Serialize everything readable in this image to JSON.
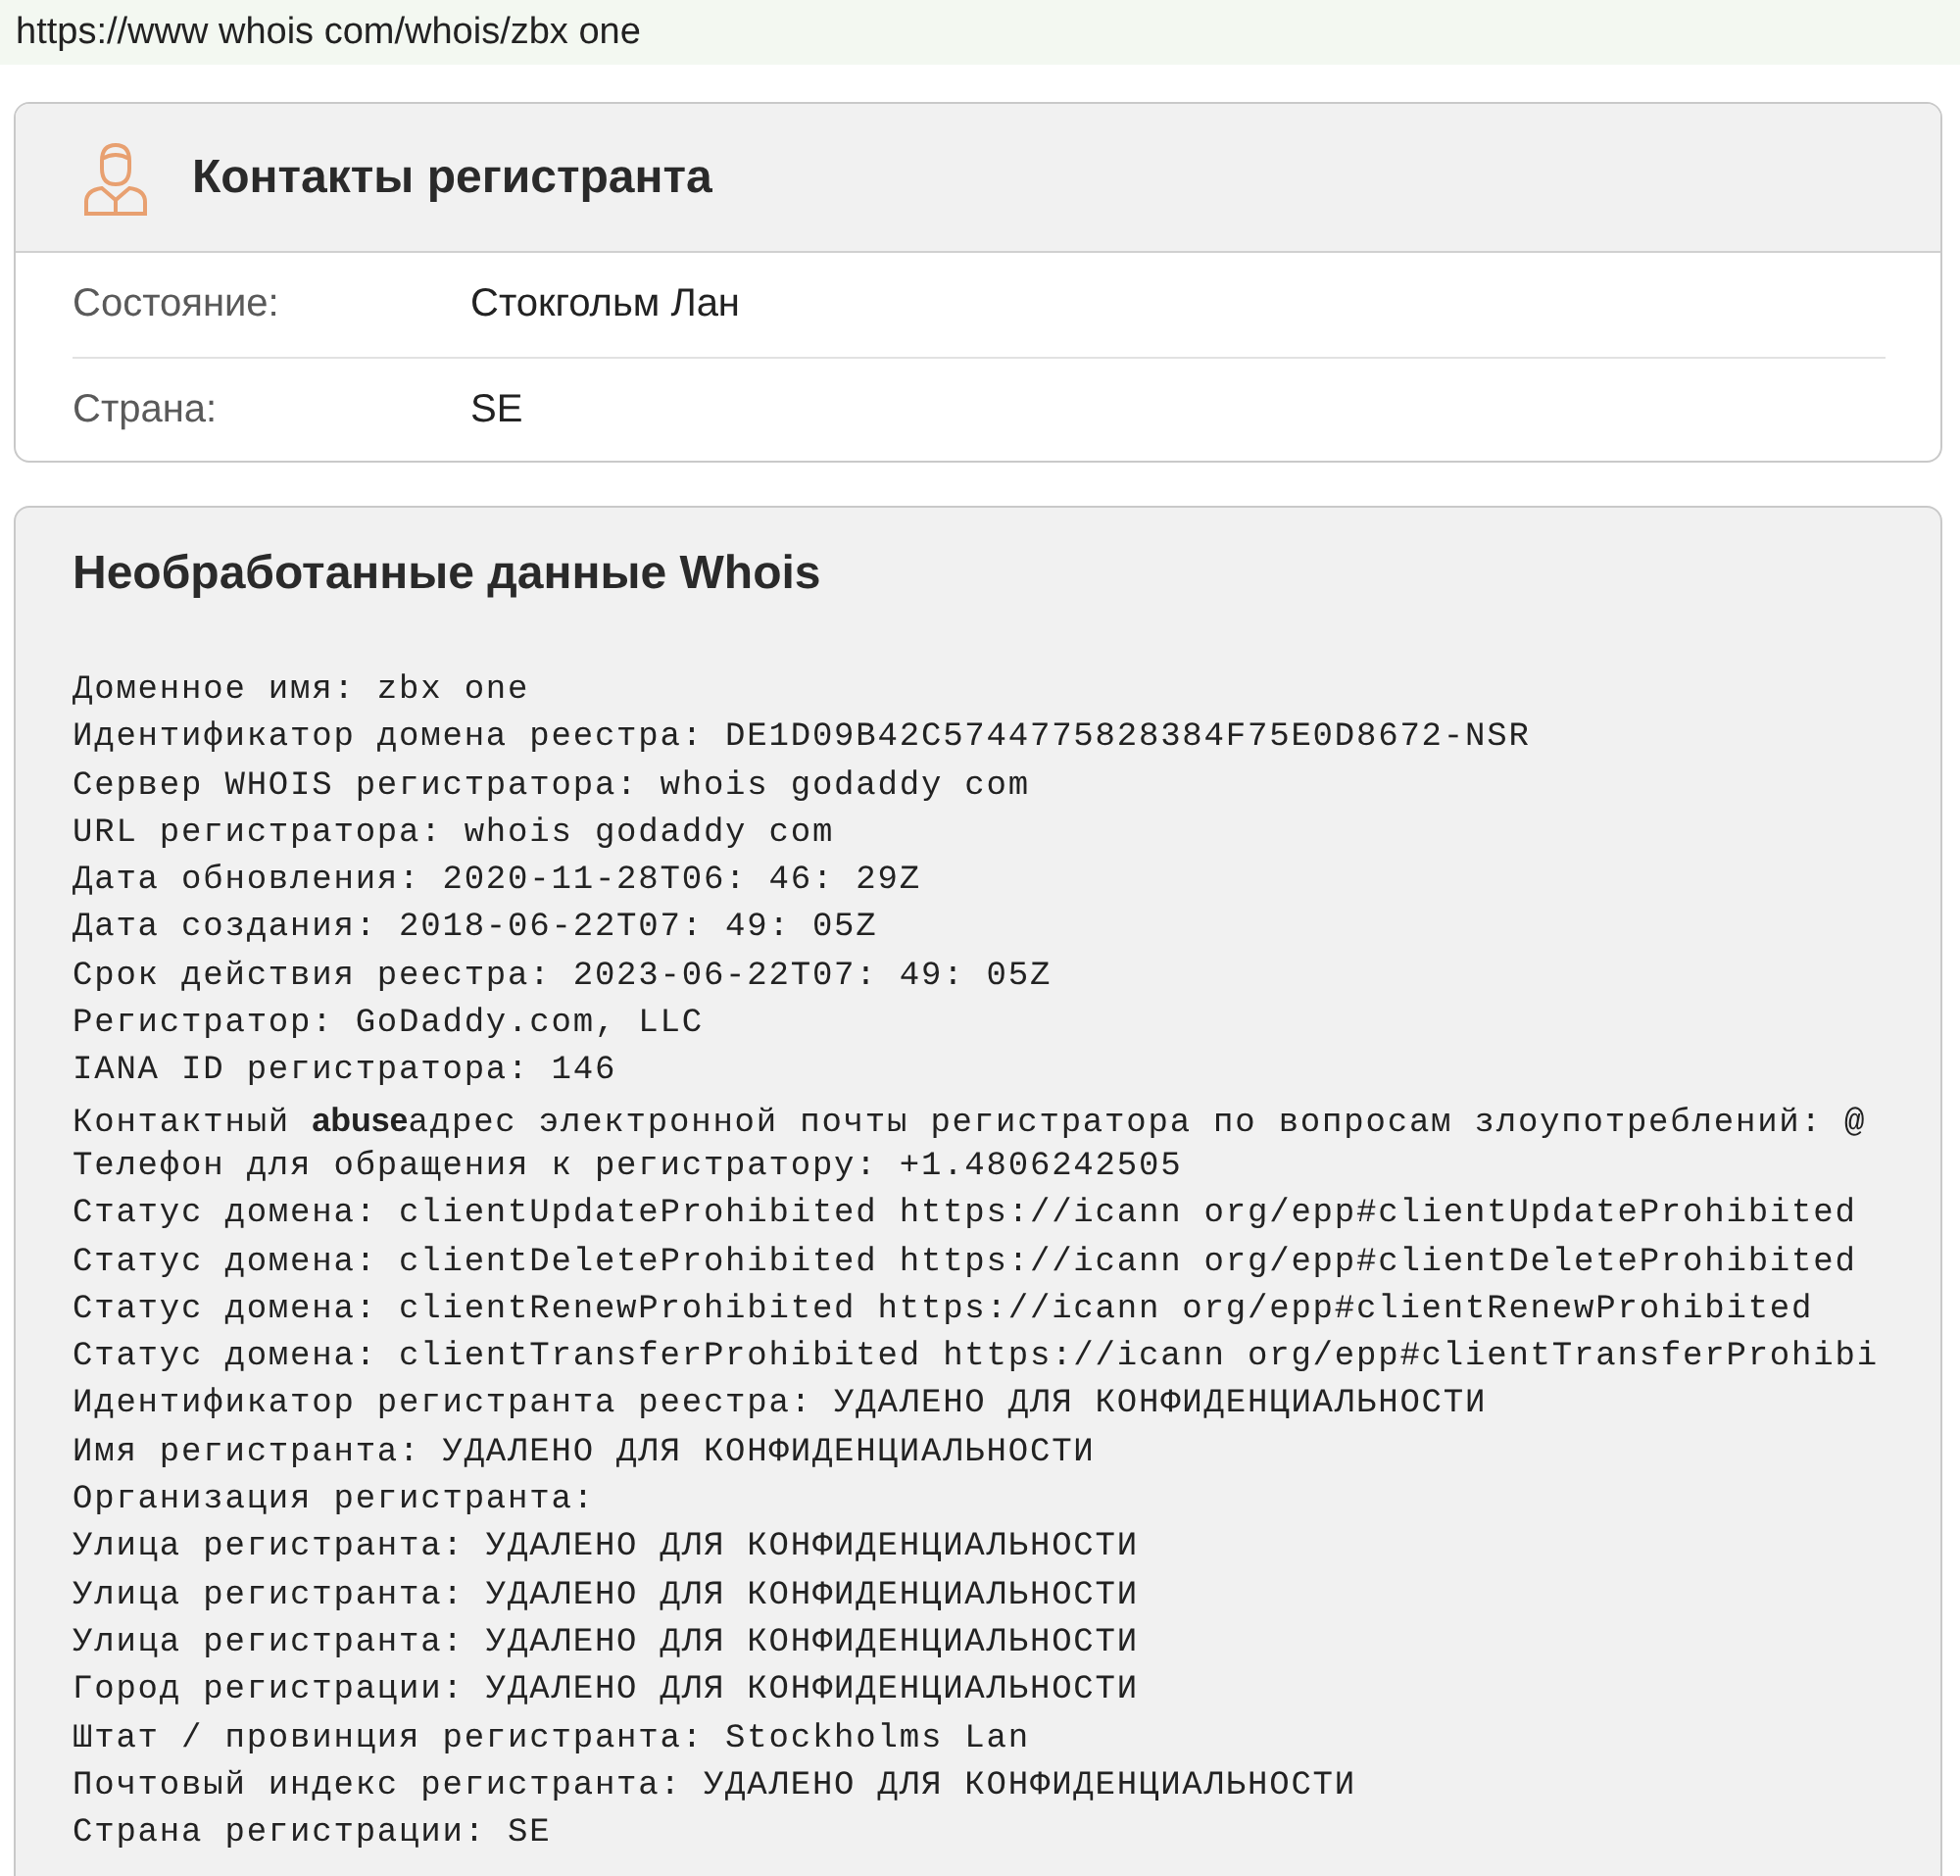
{
  "address_bar": {
    "url": "https://www whois com/whois/zbx one"
  },
  "registrant_contacts": {
    "title": "Контакты регистранта",
    "rows": [
      {
        "label": "Состояние:",
        "value": "Стокгольм Лан"
      },
      {
        "label": "Страна:",
        "value": "SE"
      }
    ]
  },
  "raw_whois": {
    "title": "Необработанные данные Whois",
    "lines": [
      "Доменное имя: zbx one",
      "Идентификатор домена реестра: DE1D09B42C5744775828384F75E0D8672-NSR",
      "Сервер WHOIS регистратора: whois godaddy com",
      "URL регистратора: whois godaddy com",
      "Дата обновления: 2020-11-28T06: 46: 29Z",
      "Дата создания: 2018-06-22T07: 49: 05Z",
      "Срок действия реестра: 2023-06-22T07: 49: 05Z",
      "Регистратор: GoDaddy.com, LLC",
      "IANA ID регистратора: 146",
      "Контактный **abuse**адрес электронной почты регистратора по вопросам злоупотреблений: @",
      "Телефон для обращения к регистратору: +1.4806242505",
      "Статус домена: clientUpdateProhibited https://icann org/epp#clientUpdateProhibited",
      "Статус домена: clientDeleteProhibited https://icann org/epp#clientDeleteProhibited",
      "Статус домена: clientRenewProhibited https://icann org/epp#clientRenewProhibited",
      "Статус домена: clientTransferProhibited https://icann org/epp#clientTransferProhibi",
      "Идентификатор регистранта реестра: УДАЛЕНО ДЛЯ КОНФИДЕНЦИАЛЬНОСТИ",
      "Имя регистранта: УДАЛЕНО ДЛЯ КОНФИДЕНЦИАЛЬНОСТИ",
      "Организация регистранта:",
      "Улица регистранта: УДАЛЕНО ДЛЯ КОНФИДЕНЦИАЛЬНОСТИ",
      "Улица регистранта: УДАЛЕНО ДЛЯ КОНФИДЕНЦИАЛЬНОСТИ",
      "Улица регистранта: УДАЛЕНО ДЛЯ КОНФИДЕНЦИАЛЬНОСТИ",
      "Город регистрации: УДАЛЕНО ДЛЯ КОНФИДЕНЦИАЛЬНОСТИ",
      "Штат / провинция регистранта: Stockholms Lan",
      "Почтовый индекс регистранта: УДАЛЕНО ДЛЯ КОНФИДЕНЦИАЛЬНОСТИ",
      "Страна регистрации: SE"
    ]
  }
}
